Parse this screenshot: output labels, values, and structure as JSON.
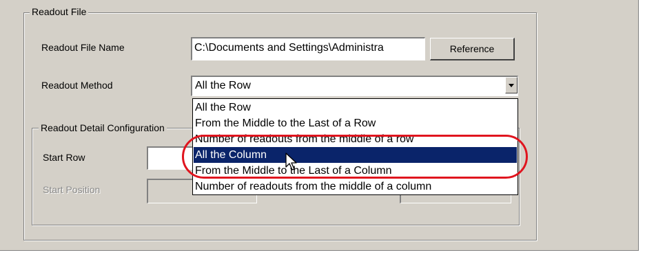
{
  "readout_file_group": {
    "title": "Readout File",
    "file_name_label": "Readout File Name",
    "file_name_value": "C:\\Documents and Settings\\Administra",
    "reference_button": "Reference",
    "method_label": "Readout Method",
    "method_selected": "All the Row"
  },
  "dropdown": {
    "options": [
      "All the Row",
      "From the Middle to the Last of a Row",
      "Number of readouts from the middle of a row",
      "All the Column",
      "From the Middle to the Last of a Column",
      "Number of readouts from the middle of a column"
    ],
    "selected_index": 3
  },
  "detail_group": {
    "title": "Readout Detail Configuration",
    "start_row_label": "Start Row",
    "start_position_label": "Start Position"
  },
  "colors": {
    "panel": "#d4d0c8",
    "selection": "#0a246a",
    "annotation": "#e0141e"
  },
  "icons": {
    "cursor": "mouse-pointer-icon",
    "dropdown_arrow": "chevron-down-icon"
  }
}
